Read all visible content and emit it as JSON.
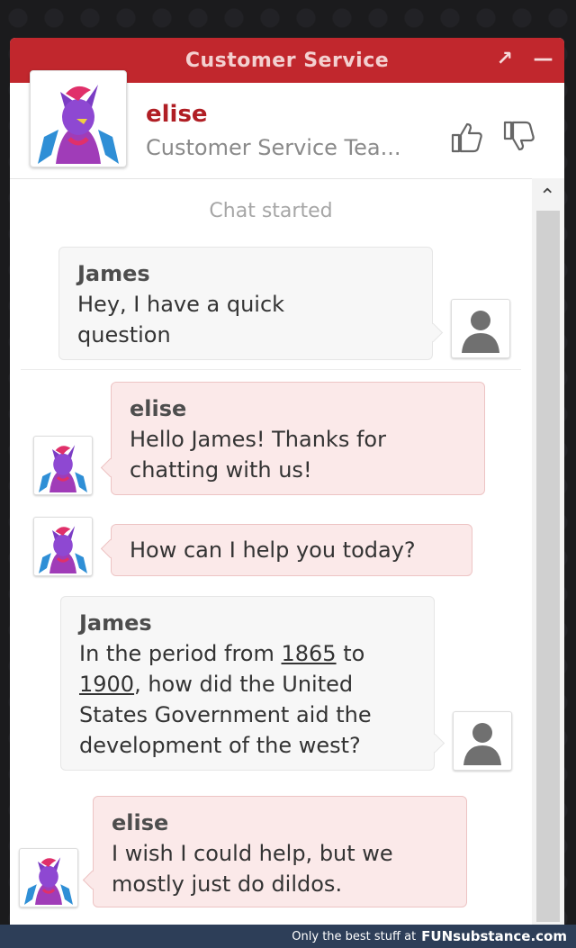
{
  "window": {
    "title": "Customer Service",
    "popout_icon": "↗",
    "minimize_icon": "—"
  },
  "agent": {
    "name": "elise",
    "team": "Customer Service Tea..."
  },
  "chat": {
    "started": "Chat started",
    "messages": [
      {
        "sender": "James",
        "line1": "Hey, I have a quick",
        "line2": "question"
      },
      {
        "sender": "elise",
        "line1": "Hello James! Thanks for",
        "line2": "chatting with us!"
      },
      {
        "text": "How can I help you today?"
      },
      {
        "sender": "James",
        "pre": "In the period from ",
        "y1": "1865",
        "mid": " to",
        "y2": "1900",
        "rest1": ", how did the United",
        "line3": "States Government aid the",
        "line4": "development of the west?"
      },
      {
        "sender": "elise",
        "line1": "I wish I could help, but we",
        "line2": "mostly just do dildos."
      }
    ]
  },
  "footer": {
    "text": "Only the best stuff at",
    "brand": "FUNsubstance.com"
  },
  "colors": {
    "accent": "#c1272d",
    "agent_bubble": "#fbe9e9",
    "user_bubble": "#f7f7f7"
  }
}
